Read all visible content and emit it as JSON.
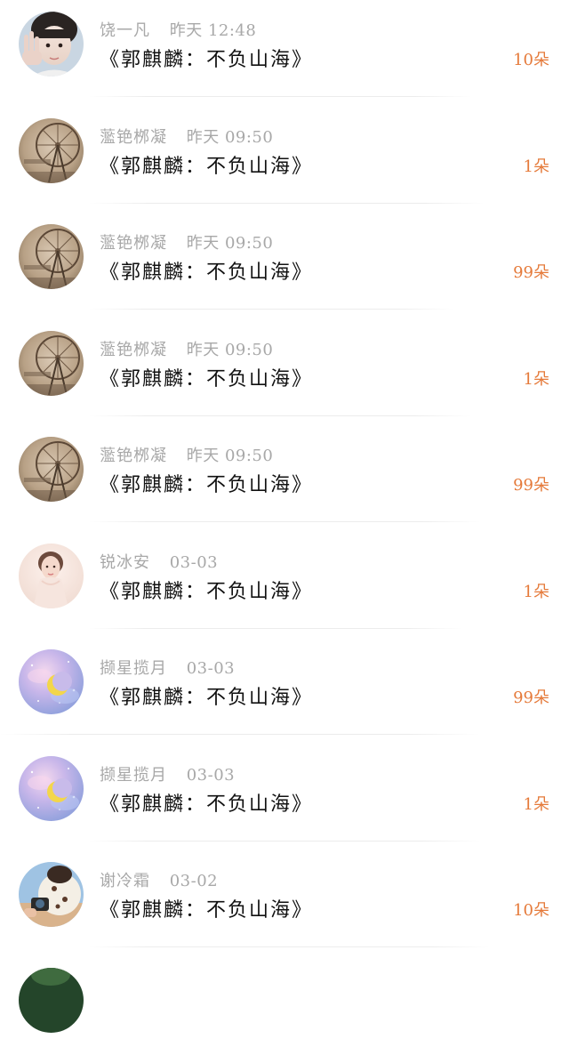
{
  "gift_list": {
    "items": [
      {
        "name": "饶一凡",
        "time": "昨天 12:48",
        "title": "《郭麒麟：不负山海》",
        "gift": "10朵",
        "avatar": "girl-photo-avatar"
      },
      {
        "name": "蘫铯桞凝",
        "time": "昨天 09:50",
        "title": "《郭麒麟：不负山海》",
        "gift": "1朵",
        "avatar": "ferris-wheel-avatar"
      },
      {
        "name": "蘫铯桞凝",
        "time": "昨天 09:50",
        "title": "《郭麒麟：不负山海》",
        "gift": "99朵",
        "avatar": "ferris-wheel-avatar"
      },
      {
        "name": "蘫铯桞凝",
        "time": "昨天 09:50",
        "title": "《郭麒麟：不负山海》",
        "gift": "1朵",
        "avatar": "ferris-wheel-avatar"
      },
      {
        "name": "蘫铯桞凝",
        "time": "昨天 09:50",
        "title": "《郭麒麟：不负山海》",
        "gift": "99朵",
        "avatar": "ferris-wheel-avatar"
      },
      {
        "name": "锐冰安",
        "time": "03-03",
        "title": "《郭麒麟：不负山海》",
        "gift": "1朵",
        "avatar": "woman-portrait-avatar"
      },
      {
        "name": "撷星揽月",
        "time": "03-03",
        "title": "《郭麒麟：不负山海》",
        "gift": "99朵",
        "avatar": "crescent-moon-avatar"
      },
      {
        "name": "撷星揽月",
        "time": "03-03",
        "title": "《郭麒麟：不负山海》",
        "gift": "1朵",
        "avatar": "crescent-moon-avatar"
      },
      {
        "name": "谢冷霜",
        "time": "03-02",
        "title": "《郭麒麟：不负山海》",
        "gift": "10朵",
        "avatar": "camera-person-avatar"
      }
    ],
    "partial_avatar": "green-avatar"
  },
  "colors": {
    "meta_text": "#a8a8a8",
    "title_text": "#111111",
    "gift_text": "#e57a3a",
    "divider": "#ececec"
  }
}
